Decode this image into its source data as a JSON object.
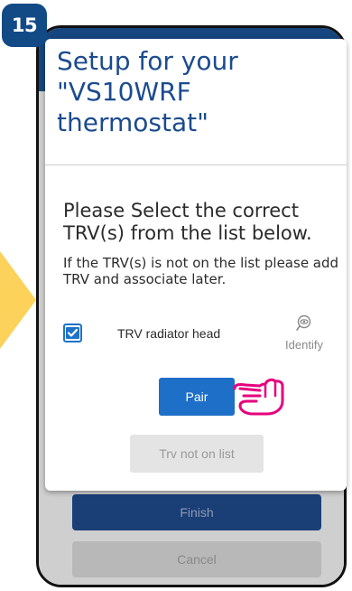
{
  "step": {
    "number": "15"
  },
  "dialog": {
    "title": "Setup for your \"VS10WRF thermostat\"",
    "instruction": "Please Select the correct TRV(s) from the list below.",
    "instruction_sub": "If the TRV(s) is not on the list please add TRV and associate later.",
    "device_item": {
      "label": "TRV radiator head",
      "checked": true,
      "identify_label": "Identify",
      "identify_icon": "identify-eye-icon"
    },
    "pair_label": "Pair",
    "not_on_list_label": "Trv not on list"
  },
  "background": {
    "finish_label": "Finish",
    "cancel_label": "Cancel"
  },
  "colors": {
    "brand": "#16467f",
    "primary_button": "#1e6fc7",
    "badge": "#124a86",
    "arrow": "#fcd25a",
    "hand": "#e6007e"
  }
}
